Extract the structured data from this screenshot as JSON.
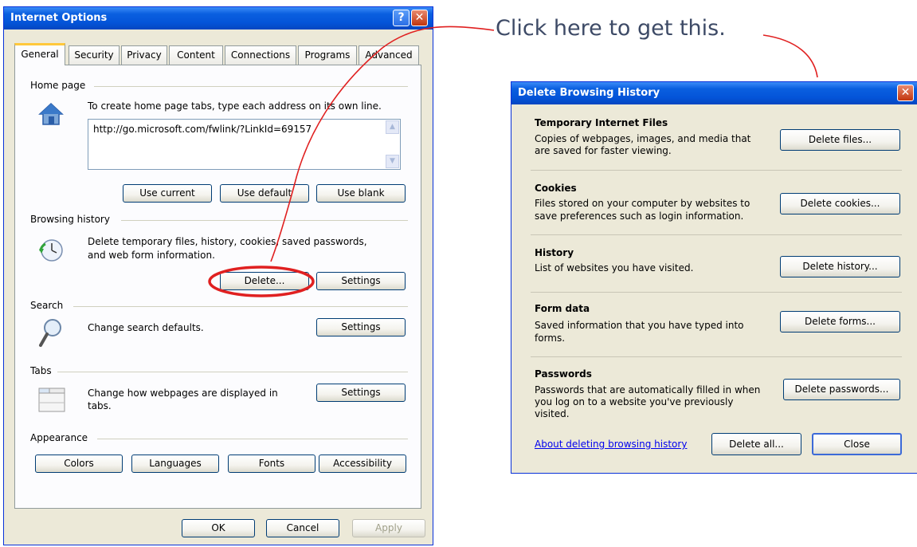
{
  "callout_text": "Click here to get this.",
  "internet_options": {
    "title": "Internet Options",
    "help_glyph": "?",
    "close_glyph": "✕",
    "tabs": [
      "General",
      "Security",
      "Privacy",
      "Content",
      "Connections",
      "Programs",
      "Advanced"
    ],
    "home_page": {
      "heading": "Home page",
      "description": "To create home page tabs, type each address on its own line.",
      "url": "http://go.microsoft.com/fwlink/?LinkId=69157",
      "use_current": "Use current",
      "use_default": "Use default",
      "use_blank": "Use blank"
    },
    "browsing_history": {
      "heading": "Browsing history",
      "description_line1": "Delete temporary files, history, cookies, saved passwords,",
      "description_line2": "and web form information.",
      "delete": "Delete...",
      "settings": "Settings"
    },
    "search": {
      "heading": "Search",
      "description": "Change search defaults.",
      "settings": "Settings"
    },
    "tabs_section": {
      "heading": "Tabs",
      "description_line1": "Change how webpages are displayed in",
      "description_line2": "tabs.",
      "settings": "Settings"
    },
    "appearance": {
      "heading": "Appearance",
      "colors": "Colors",
      "languages": "Languages",
      "fonts": "Fonts",
      "accessibility": "Accessibility"
    },
    "ok": "OK",
    "cancel": "Cancel",
    "apply": "Apply"
  },
  "delete_dialog": {
    "title": "Delete Browsing History",
    "close_glyph": "✕",
    "sections": [
      {
        "heading": "Temporary Internet Files",
        "line1": "Copies of webpages, images, and media that",
        "line2": "are saved for faster viewing.",
        "line3": "",
        "button": "Delete files..."
      },
      {
        "heading": "Cookies",
        "line1": "Files stored on your computer by websites to",
        "line2": "save preferences such as login information.",
        "line3": "",
        "button": "Delete cookies..."
      },
      {
        "heading": "History",
        "line1": "List of websites you have visited.",
        "line2": "",
        "line3": "",
        "button": "Delete history..."
      },
      {
        "heading": "Form data",
        "line1": "Saved information that you have typed into",
        "line2": "forms.",
        "line3": "",
        "button": "Delete forms..."
      },
      {
        "heading": "Passwords",
        "line1": "Passwords that are automatically filled in when",
        "line2": "you log on to a website you've previously",
        "line3": "visited.",
        "button": "Delete passwords..."
      }
    ],
    "about_link": "About deleting browsing history",
    "delete_all": "Delete all...",
    "close": "Close"
  }
}
